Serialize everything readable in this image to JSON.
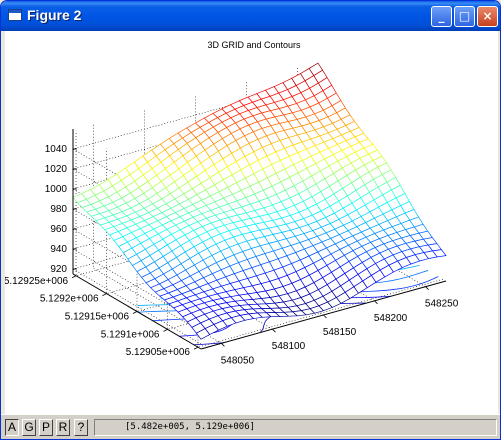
{
  "window": {
    "title": "Figure 2",
    "buttons": [
      "_",
      "□",
      "×"
    ]
  },
  "chart_data": {
    "type": "surface",
    "title": "3D GRID and Contours",
    "xlabel": "",
    "ylabel": "",
    "zlabel": "",
    "x_axis_ticks": [
      "548050",
      "548100",
      "548150",
      "548200",
      "548250"
    ],
    "y_axis_ticks": [
      "5.12905e+006",
      "5.1291e+006",
      "5.12915e+006",
      "5.1292e+006",
      "5.12925e+006"
    ],
    "z_axis_ticks": [
      "920",
      "940",
      "960",
      "980",
      "1000",
      "1020",
      "1040"
    ],
    "xlim": [
      548030,
      548270
    ],
    "ylim": [
      5129045,
      5129255
    ],
    "zlim": [
      915,
      1060
    ],
    "grid": true,
    "colormap": "jet",
    "contours_projected_below": true,
    "surface_corner_values": {
      "xmin_ymin": 925,
      "xmax_ymin": 938,
      "xmin_ymax": 995,
      "xmax_ymax": 1055
    }
  },
  "statusbar": {
    "tool_buttons": [
      "A",
      "G",
      "P",
      "R",
      "?"
    ],
    "pressed_button": "A",
    "coordinates": "[5.482e+005, 5.129e+006]"
  }
}
